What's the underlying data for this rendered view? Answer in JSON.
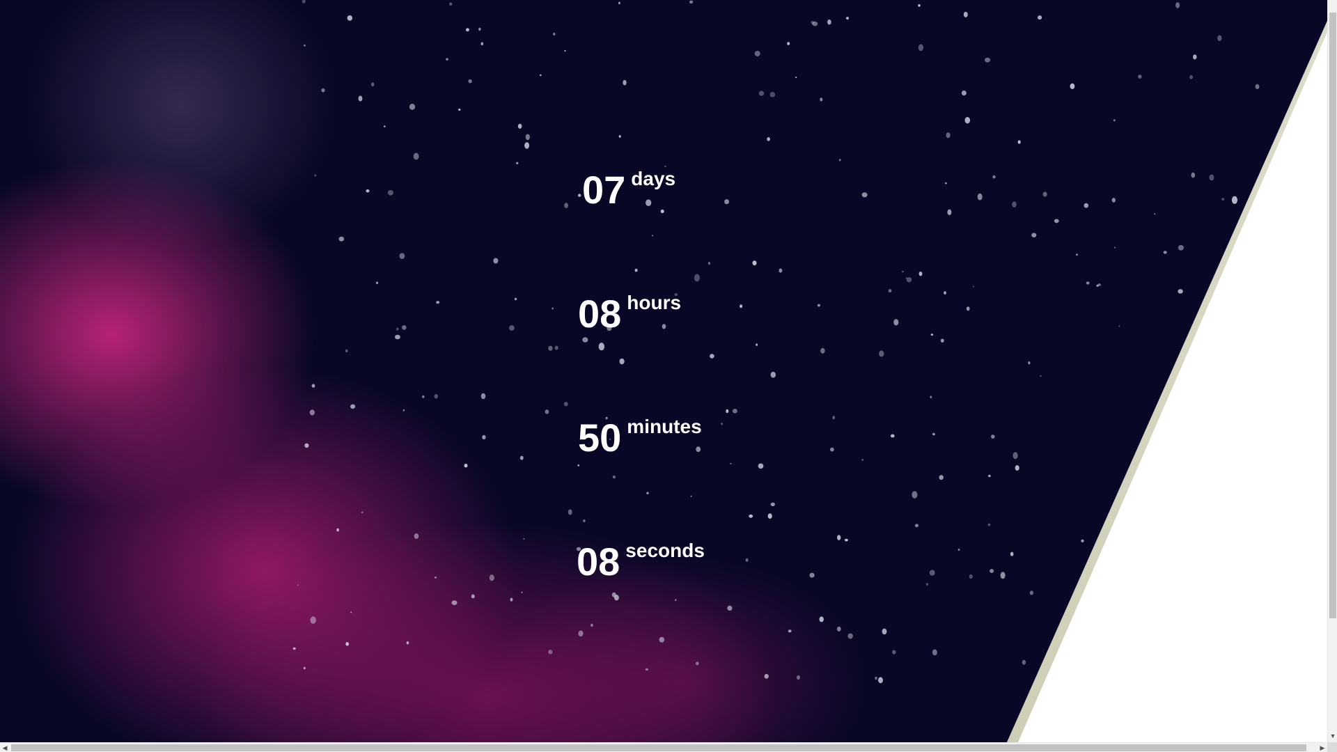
{
  "countdown": {
    "days": {
      "value": "07",
      "label": "days"
    },
    "hours": {
      "value": "08",
      "label": "hours"
    },
    "minutes": {
      "value": "50",
      "label": "minutes"
    },
    "seconds": {
      "value": "08",
      "label": "seconds"
    }
  },
  "colors": {
    "background": "#080726",
    "nebula": "#d62882",
    "text": "#ffffff",
    "page": "#ffffff"
  },
  "icons": {
    "scroll_left": "arrow-left-icon",
    "scroll_right": "arrow-right-icon",
    "scroll_down": "arrow-down-icon"
  }
}
